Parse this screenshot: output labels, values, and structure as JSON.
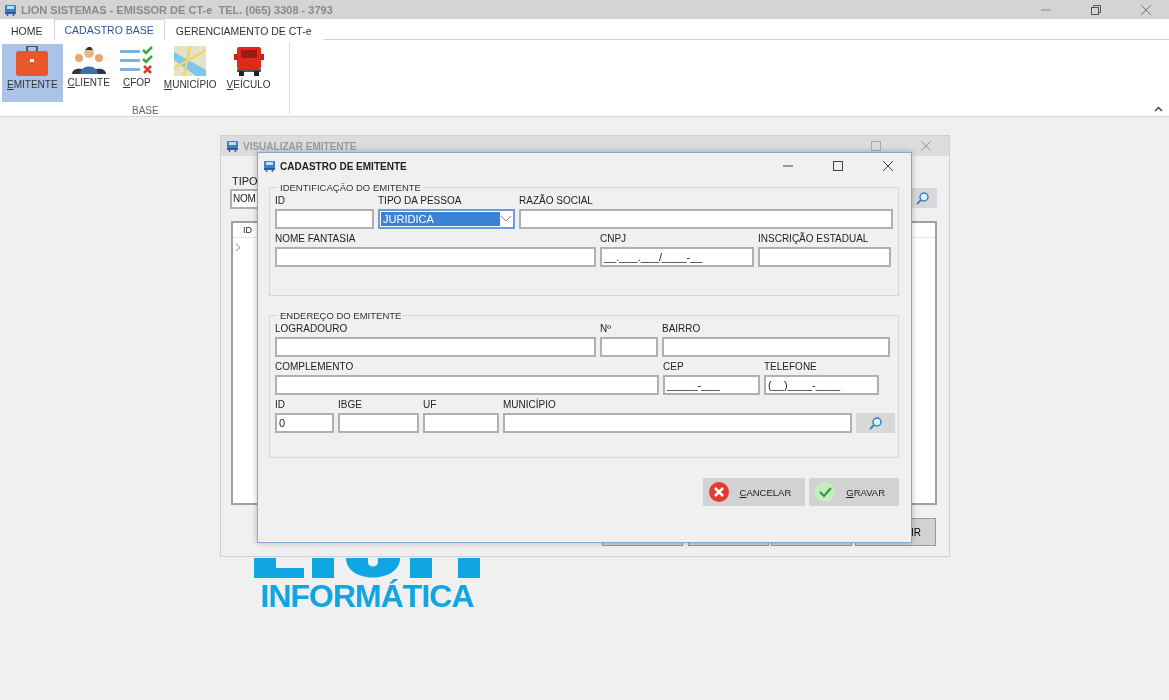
{
  "title_bar": {
    "title": "LION SISTEMAS - EMISSOR DE CT-e  TEL. (065) 3308 - 3793"
  },
  "ribbon": {
    "tabs": [
      {
        "label": "HOME",
        "selected": false
      },
      {
        "label": "CADASTRO BASE",
        "selected": true
      },
      {
        "label": "GERENCIAMENTO DE CT-e",
        "selected": false
      }
    ],
    "items": [
      {
        "label": "EMITENTE",
        "kind": "briefcase",
        "selected": true
      },
      {
        "label": "CLIENTE",
        "kind": "people",
        "selected": false
      },
      {
        "label": "CFOP",
        "kind": "checklist",
        "selected": false
      },
      {
        "label": "MUNICÍPIO",
        "kind": "map",
        "selected": false
      },
      {
        "label": "VEÍCULO",
        "kind": "truck",
        "selected": false
      }
    ],
    "group_label": "BASE"
  },
  "back_window": {
    "title": "VISUALIZAR EMITENTE",
    "filter_label": "TIPO",
    "filter_value": "NOM",
    "grid_column": "ID",
    "last_button": "IR"
  },
  "dialog": {
    "title": "CADASTRO DE EMITENTE",
    "groups": [
      {
        "title": "IDENTIFICAÇÃO DO EMITENTE",
        "rows": [
          [
            {
              "label": "ID",
              "kind": "text"
            },
            {
              "label": "TIPO DA PESSOA",
              "kind": "select",
              "value": "JURIDICA",
              "focused": true
            },
            {
              "label": "RAZÃO SOCIAL",
              "kind": "text"
            }
          ],
          [
            {
              "label": "NOME FANTASIA",
              "kind": "text"
            },
            {
              "label": "CNPJ",
              "kind": "text",
              "value": "__.___.___/____-__"
            },
            {
              "label": "INSCRIÇÃO ESTADUAL",
              "kind": "text"
            }
          ]
        ]
      },
      {
        "title": "ENDEREÇO DO EMITENTE",
        "rows": [
          [
            {
              "label": "LOGRADOURO",
              "kind": "text"
            },
            {
              "label": "Nº",
              "kind": "text"
            },
            {
              "label": "BAIRRO",
              "kind": "text"
            }
          ],
          [
            {
              "label": "COMPLEMENTO",
              "kind": "text"
            },
            {
              "label": "CEP",
              "kind": "text",
              "value": "_____-___"
            },
            {
              "label": "TELEFONE",
              "kind": "text",
              "value": "(__)____-____"
            }
          ],
          [
            {
              "label": "ID",
              "kind": "text",
              "value": "0"
            },
            {
              "label": "IBGE",
              "kind": "text"
            },
            {
              "label": "UF",
              "kind": "text"
            },
            {
              "label": "MUNICÍPIO",
              "kind": "text"
            },
            {
              "kind": "search"
            }
          ]
        ]
      }
    ],
    "buttons": [
      {
        "label": "CANCELAR",
        "kind": "cancel"
      },
      {
        "label": "GRAVAR",
        "kind": "save"
      }
    ]
  },
  "logo": {
    "text": "INFORMÁTICA"
  }
}
